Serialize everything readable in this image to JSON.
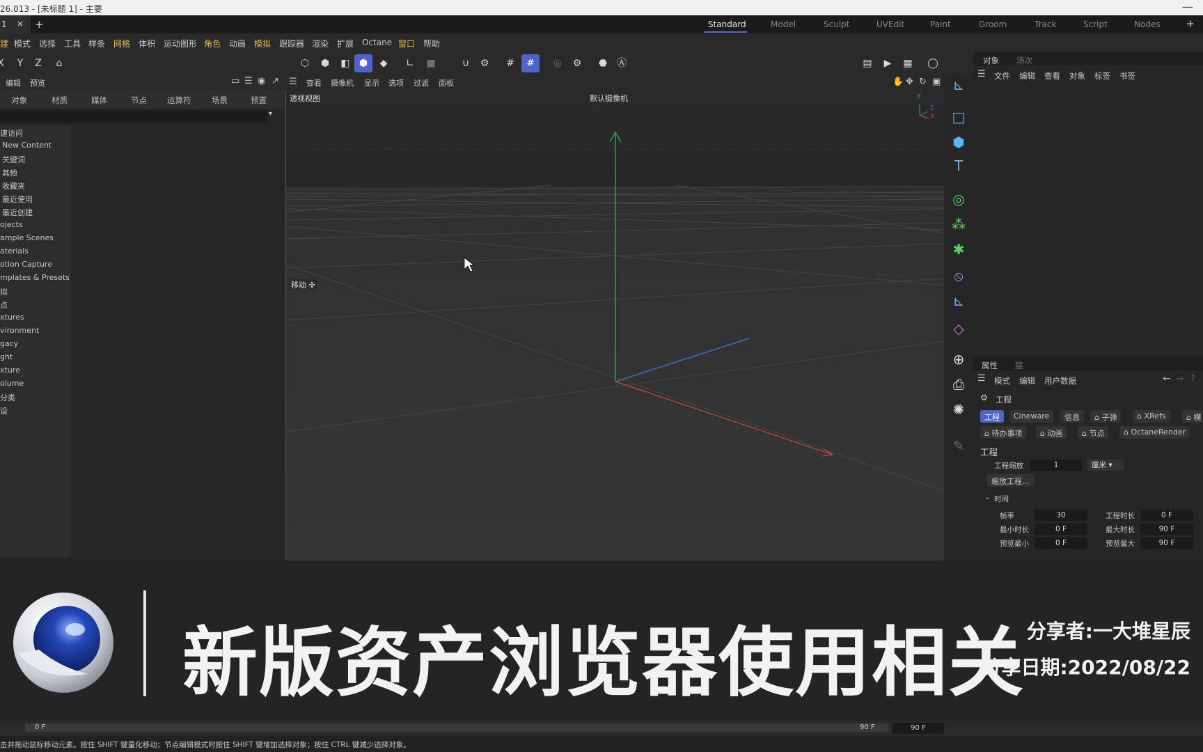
{
  "window": {
    "title": "26.013 - [未标题 1] - 主要",
    "minimize": "—"
  },
  "tabs": {
    "doc_tab": "1",
    "close": "×",
    "add": "+"
  },
  "layouts": [
    "Standard",
    "Model",
    "Sculpt",
    "UVEdit",
    "Paint",
    "Groom",
    "Track",
    "Script",
    "Nodes"
  ],
  "layouts_add": "+",
  "menu": [
    "建",
    "模式",
    "选择",
    "工具",
    "样条",
    "网格",
    "体积",
    "运动图形",
    "角色",
    "动画",
    "模拟",
    "跟踪器",
    "渲染",
    "扩展",
    "Octane",
    "窗口",
    "帮助"
  ],
  "toolbar": {
    "x": "X",
    "y": "Y",
    "z": "Z"
  },
  "left_panel": {
    "header": [
      "编辑",
      "预览"
    ],
    "tabs": [
      "对象",
      "材质",
      "媒体",
      "节点",
      "运算符",
      "场景",
      "预置"
    ],
    "tree": [
      "速访问",
      "New Content",
      "关键词",
      "其他",
      "收藏夹",
      "最近使用",
      "最近创建",
      "ojects",
      "ample Scenes",
      "aterials",
      "otion Capture",
      "mplates & Presets",
      "拟",
      "点",
      "xtures",
      "vironment",
      "gacy",
      "ght",
      "xture",
      "olume",
      "分类",
      "设"
    ]
  },
  "viewport": {
    "menu": [
      "查看",
      "摄像机",
      "显示",
      "选项",
      "过滤",
      "面板"
    ],
    "view_name": "透视视图",
    "camera": "默认摄像机",
    "tool_hint": "移动",
    "axes": {
      "y": "Y",
      "z": "Z",
      "x": "X"
    },
    "axis_colors": {
      "x": "#c9473d",
      "y": "#3db15b",
      "z": "#3a6fd0"
    }
  },
  "object_panel": {
    "tabs": [
      "对象",
      "场次"
    ],
    "menu": [
      "文件",
      "编辑",
      "查看",
      "对象",
      "标签",
      "书签"
    ]
  },
  "attributes": {
    "tabs": [
      "属性",
      "层"
    ],
    "menu": [
      "模式",
      "编辑",
      "用户数据"
    ],
    "object": "工程",
    "tags_row1": [
      "工程",
      "Cineware",
      "信息",
      "子弹",
      "XRefs",
      "模"
    ],
    "tags_row2": [
      "待办事项",
      "动画",
      "节点",
      "OctaneRender"
    ],
    "section": "工程",
    "scale_label": "工程缩放",
    "scale_value": "1",
    "scale_unit": "厘米",
    "scale_button": "缩放工程...",
    "time_section": "时间",
    "fields": {
      "fps_label": "帧率",
      "fps": "30",
      "proj_len_label": "工程时长",
      "proj_len": "0 F",
      "min_len_label": "最小时长",
      "min_len": "0 F",
      "max_len_label": "最大时长",
      "max_len": "90 F",
      "prev_min_label": "预览最小",
      "prev_min": "0 F",
      "prev_max_label": "预览最大",
      "prev_max": "90 F"
    }
  },
  "banner": {
    "title": "新版资产浏览器使用相关",
    "sharer": "分享者:一大堆星辰",
    "date": "分享日期:2022/08/22"
  },
  "timeline": {
    "start": "0 F",
    "end": "90 F",
    "end2": "90 F"
  },
  "status": "击并拖动鼠标移动元素。按住 SHIFT 键量化移动；节点编辑模式时按住 SHIFT 键增加选择对象；按住 CTRL 键减少选择对象。"
}
